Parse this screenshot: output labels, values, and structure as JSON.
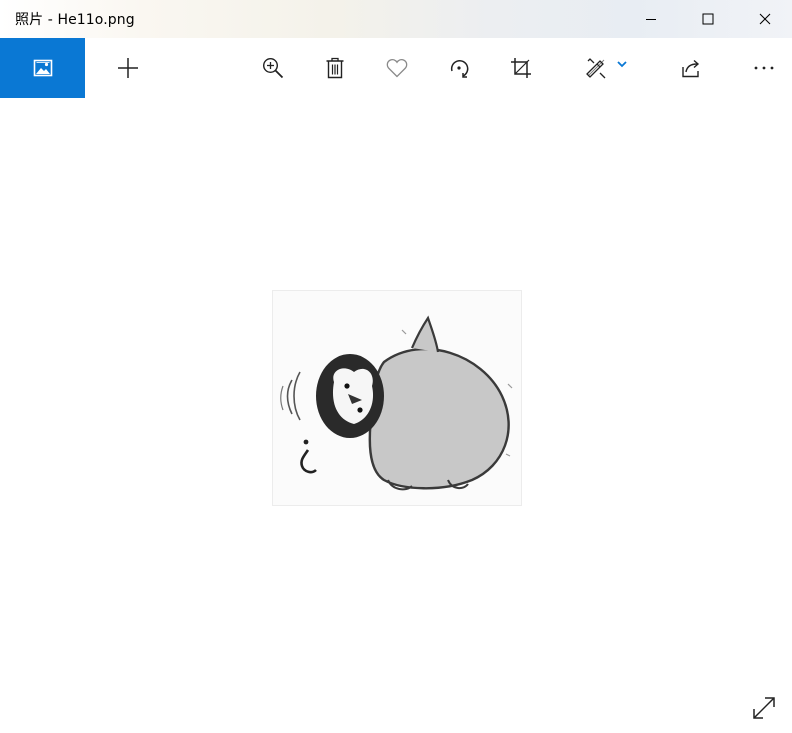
{
  "window": {
    "title": "照片 - He11o.png",
    "minimize_icon": "minimize-icon",
    "maximize_icon": "maximize-icon",
    "close_icon": "close-icon"
  },
  "toolbar": {
    "accent_color": "#0a78d4",
    "buttons": [
      {
        "id": "gallery",
        "icon": "photo-gallery-icon"
      },
      {
        "id": "add",
        "icon": "plus-icon"
      },
      {
        "id": "zoom",
        "icon": "zoom-in-icon"
      },
      {
        "id": "delete",
        "icon": "trash-icon"
      },
      {
        "id": "favorite",
        "icon": "heart-icon"
      },
      {
        "id": "rotate",
        "icon": "rotate-icon"
      },
      {
        "id": "crop",
        "icon": "crop-icon"
      },
      {
        "id": "edit",
        "icon": "edit-create-icon",
        "has_dropdown": true
      },
      {
        "id": "share",
        "icon": "share-icon"
      },
      {
        "id": "more",
        "icon": "more-icon"
      }
    ]
  },
  "viewer": {
    "image_subject": "penguin-sticker",
    "expand_icon": "fullscreen-expand-icon"
  }
}
